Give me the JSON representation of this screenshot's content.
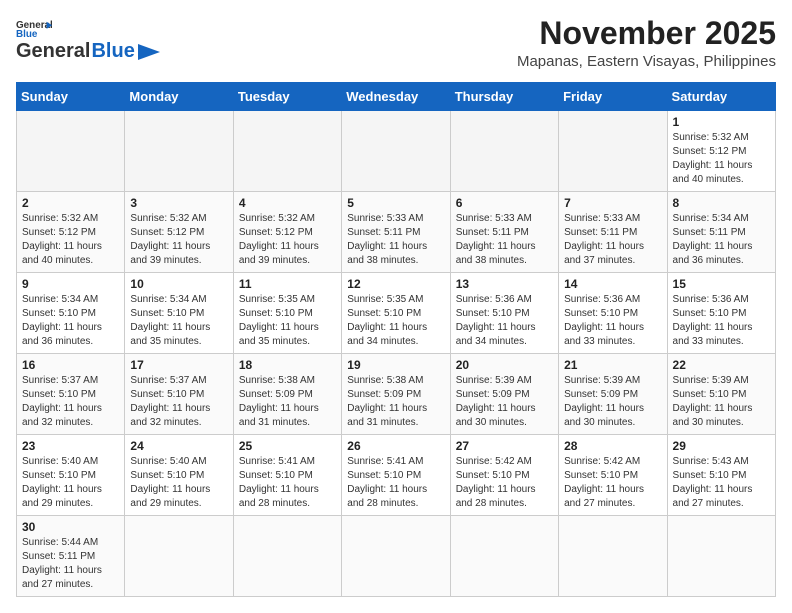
{
  "header": {
    "logo_general": "General",
    "logo_blue": "Blue",
    "month_year": "November 2025",
    "location": "Mapanas, Eastern Visayas, Philippines"
  },
  "days_of_week": [
    "Sunday",
    "Monday",
    "Tuesday",
    "Wednesday",
    "Thursday",
    "Friday",
    "Saturday"
  ],
  "weeks": [
    {
      "days": [
        {
          "num": "",
          "info": ""
        },
        {
          "num": "",
          "info": ""
        },
        {
          "num": "",
          "info": ""
        },
        {
          "num": "",
          "info": ""
        },
        {
          "num": "",
          "info": ""
        },
        {
          "num": "",
          "info": ""
        },
        {
          "num": "1",
          "info": "Sunrise: 5:32 AM\nSunset: 5:12 PM\nDaylight: 11 hours and 40 minutes."
        }
      ]
    },
    {
      "days": [
        {
          "num": "2",
          "info": "Sunrise: 5:32 AM\nSunset: 5:12 PM\nDaylight: 11 hours and 40 minutes."
        },
        {
          "num": "3",
          "info": "Sunrise: 5:32 AM\nSunset: 5:12 PM\nDaylight: 11 hours and 39 minutes."
        },
        {
          "num": "4",
          "info": "Sunrise: 5:32 AM\nSunset: 5:12 PM\nDaylight: 11 hours and 39 minutes."
        },
        {
          "num": "5",
          "info": "Sunrise: 5:33 AM\nSunset: 5:11 PM\nDaylight: 11 hours and 38 minutes."
        },
        {
          "num": "6",
          "info": "Sunrise: 5:33 AM\nSunset: 5:11 PM\nDaylight: 11 hours and 38 minutes."
        },
        {
          "num": "7",
          "info": "Sunrise: 5:33 AM\nSunset: 5:11 PM\nDaylight: 11 hours and 37 minutes."
        },
        {
          "num": "8",
          "info": "Sunrise: 5:34 AM\nSunset: 5:11 PM\nDaylight: 11 hours and 36 minutes."
        }
      ]
    },
    {
      "days": [
        {
          "num": "9",
          "info": "Sunrise: 5:34 AM\nSunset: 5:10 PM\nDaylight: 11 hours and 36 minutes."
        },
        {
          "num": "10",
          "info": "Sunrise: 5:34 AM\nSunset: 5:10 PM\nDaylight: 11 hours and 35 minutes."
        },
        {
          "num": "11",
          "info": "Sunrise: 5:35 AM\nSunset: 5:10 PM\nDaylight: 11 hours and 35 minutes."
        },
        {
          "num": "12",
          "info": "Sunrise: 5:35 AM\nSunset: 5:10 PM\nDaylight: 11 hours and 34 minutes."
        },
        {
          "num": "13",
          "info": "Sunrise: 5:36 AM\nSunset: 5:10 PM\nDaylight: 11 hours and 34 minutes."
        },
        {
          "num": "14",
          "info": "Sunrise: 5:36 AM\nSunset: 5:10 PM\nDaylight: 11 hours and 33 minutes."
        },
        {
          "num": "15",
          "info": "Sunrise: 5:36 AM\nSunset: 5:10 PM\nDaylight: 11 hours and 33 minutes."
        }
      ]
    },
    {
      "days": [
        {
          "num": "16",
          "info": "Sunrise: 5:37 AM\nSunset: 5:10 PM\nDaylight: 11 hours and 32 minutes."
        },
        {
          "num": "17",
          "info": "Sunrise: 5:37 AM\nSunset: 5:10 PM\nDaylight: 11 hours and 32 minutes."
        },
        {
          "num": "18",
          "info": "Sunrise: 5:38 AM\nSunset: 5:09 PM\nDaylight: 11 hours and 31 minutes."
        },
        {
          "num": "19",
          "info": "Sunrise: 5:38 AM\nSunset: 5:09 PM\nDaylight: 11 hours and 31 minutes."
        },
        {
          "num": "20",
          "info": "Sunrise: 5:39 AM\nSunset: 5:09 PM\nDaylight: 11 hours and 30 minutes."
        },
        {
          "num": "21",
          "info": "Sunrise: 5:39 AM\nSunset: 5:09 PM\nDaylight: 11 hours and 30 minutes."
        },
        {
          "num": "22",
          "info": "Sunrise: 5:39 AM\nSunset: 5:10 PM\nDaylight: 11 hours and 30 minutes."
        }
      ]
    },
    {
      "days": [
        {
          "num": "23",
          "info": "Sunrise: 5:40 AM\nSunset: 5:10 PM\nDaylight: 11 hours and 29 minutes."
        },
        {
          "num": "24",
          "info": "Sunrise: 5:40 AM\nSunset: 5:10 PM\nDaylight: 11 hours and 29 minutes."
        },
        {
          "num": "25",
          "info": "Sunrise: 5:41 AM\nSunset: 5:10 PM\nDaylight: 11 hours and 28 minutes."
        },
        {
          "num": "26",
          "info": "Sunrise: 5:41 AM\nSunset: 5:10 PM\nDaylight: 11 hours and 28 minutes."
        },
        {
          "num": "27",
          "info": "Sunrise: 5:42 AM\nSunset: 5:10 PM\nDaylight: 11 hours and 28 minutes."
        },
        {
          "num": "28",
          "info": "Sunrise: 5:42 AM\nSunset: 5:10 PM\nDaylight: 11 hours and 27 minutes."
        },
        {
          "num": "29",
          "info": "Sunrise: 5:43 AM\nSunset: 5:10 PM\nDaylight: 11 hours and 27 minutes."
        }
      ]
    },
    {
      "days": [
        {
          "num": "30",
          "info": "Sunrise: 5:44 AM\nSunset: 5:11 PM\nDaylight: 11 hours and 27 minutes."
        },
        {
          "num": "",
          "info": ""
        },
        {
          "num": "",
          "info": ""
        },
        {
          "num": "",
          "info": ""
        },
        {
          "num": "",
          "info": ""
        },
        {
          "num": "",
          "info": ""
        },
        {
          "num": "",
          "info": ""
        }
      ]
    }
  ]
}
